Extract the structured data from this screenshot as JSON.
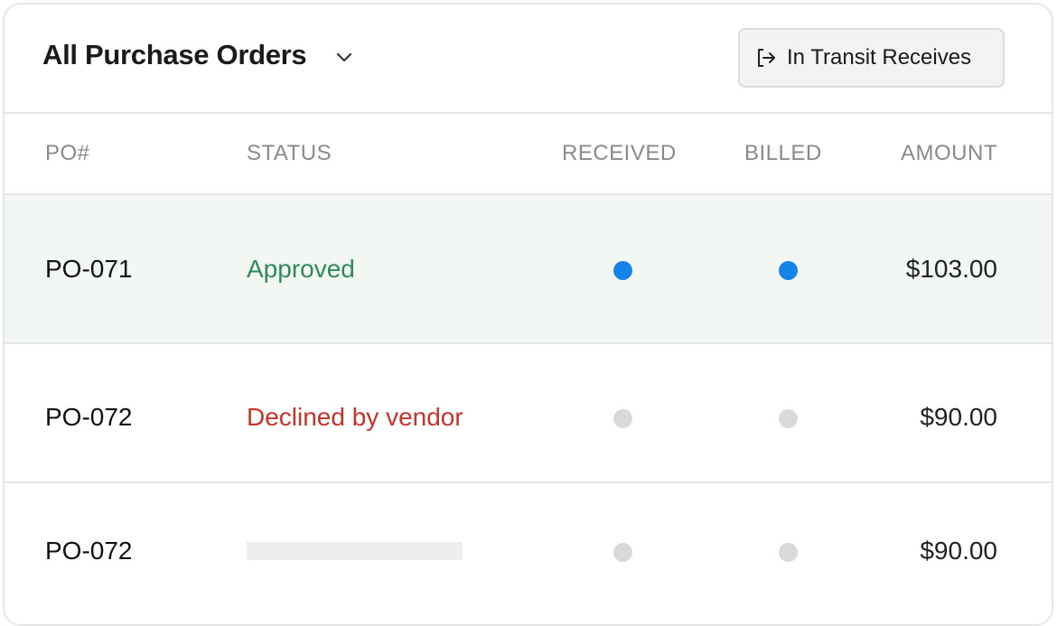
{
  "header": {
    "title": "All Purchase Orders",
    "dropdown_icon": "chevron-down-icon",
    "transit_button": {
      "label": "In Transit Receives",
      "icon": "exit-arrow-icon"
    }
  },
  "table": {
    "columns": [
      "PO#",
      "STATUS",
      "RECEIVED",
      "BILLED",
      "AMOUNT"
    ],
    "rows": [
      {
        "po": "PO-071",
        "status": "Approved",
        "status_type": "approved",
        "received": true,
        "billed": true,
        "amount": "$103.00"
      },
      {
        "po": "PO-072",
        "status": "Declined by vendor",
        "status_type": "declined",
        "received": false,
        "billed": false,
        "amount": "$90.00"
      },
      {
        "po": "PO-072",
        "status": "",
        "status_type": "loading",
        "received": false,
        "billed": false,
        "amount": "$90.00"
      }
    ]
  },
  "colors": {
    "approved": "#2f8a5a",
    "declined": "#c7322a",
    "dot_active": "#1683e8",
    "dot_inactive": "#d9d9d9",
    "selected_row_bg": "#f2f7f4"
  }
}
